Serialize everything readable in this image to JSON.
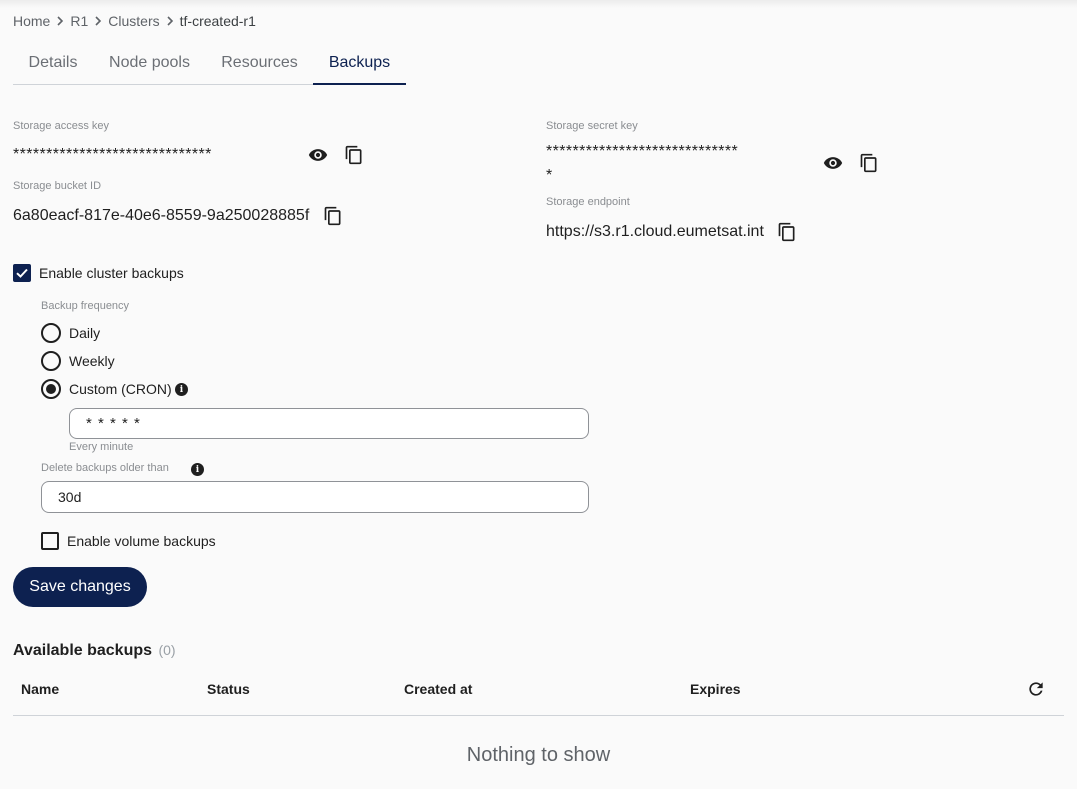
{
  "breadcrumb": {
    "items": [
      "Home",
      "R1",
      "Clusters",
      "tf-created-r1"
    ]
  },
  "tabs": [
    {
      "label": "Details",
      "active": false
    },
    {
      "label": "Node pools",
      "active": false
    },
    {
      "label": "Resources",
      "active": false
    },
    {
      "label": "Backups",
      "active": true
    }
  ],
  "storage": {
    "access_key_label": "Storage access key",
    "access_key_value": "******************************",
    "secret_key_label": "Storage secret key",
    "secret_key_value_line1": "*****************************",
    "secret_key_value_line2": "*",
    "bucket_id_label": "Storage bucket ID",
    "bucket_id_value": "6a80eacf-817e-40e6-8559-9a250028885f",
    "endpoint_label": "Storage endpoint",
    "endpoint_value": "https://s3.r1.cloud.eumetsat.int"
  },
  "backups": {
    "enable_cluster_label": "Enable cluster backups",
    "enable_cluster_checked": true,
    "frequency_label": "Backup frequency",
    "frequency_options": [
      {
        "label": "Daily",
        "selected": false
      },
      {
        "label": "Weekly",
        "selected": false
      },
      {
        "label": "Custom (CRON)",
        "selected": true
      }
    ],
    "cron_value": "* * * * *",
    "cron_hint": "Every minute",
    "delete_label": "Delete backups older than",
    "delete_value": "30d",
    "enable_volume_label": "Enable volume backups",
    "enable_volume_checked": false,
    "save_label": "Save changes"
  },
  "available": {
    "title": "Available backups",
    "count": "(0)",
    "columns": [
      "Name",
      "Status",
      "Created at",
      "Expires"
    ],
    "empty_text": "Nothing to show"
  },
  "colors": {
    "primary": "#0d2150",
    "text": "#1f1f1f",
    "muted": "#8a8d91"
  },
  "icons": [
    "chevron-right-icon",
    "eye-icon",
    "copy-icon",
    "check-icon",
    "info-icon",
    "refresh-icon"
  ]
}
